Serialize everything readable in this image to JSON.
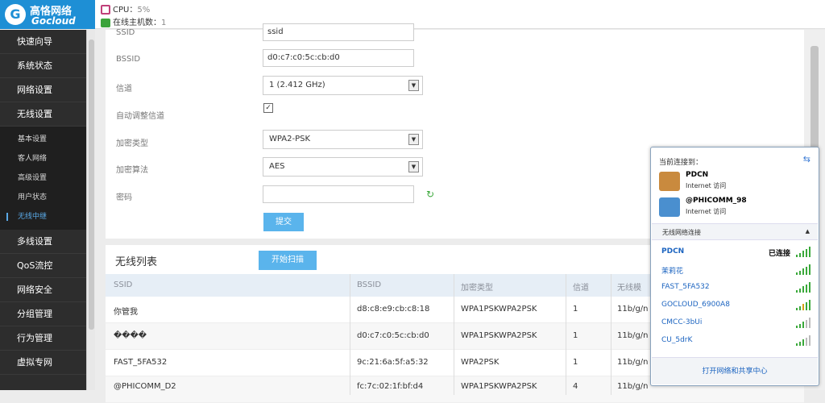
{
  "header": {
    "brand_cn": "高恪网络",
    "brand_en": "Gocloud",
    "cpu_label": "CPU：",
    "cpu_value": "5%",
    "hosts_label": "在线主机数：",
    "hosts_value": "1"
  },
  "sidebar": {
    "top_items": [
      {
        "label": "快速向导"
      },
      {
        "label": "系统状态"
      },
      {
        "label": "网络设置"
      },
      {
        "label": "无线设置"
      }
    ],
    "sub_items": [
      {
        "label": "基本设置"
      },
      {
        "label": "客人网络"
      },
      {
        "label": "高级设置"
      },
      {
        "label": "用户状态"
      },
      {
        "label": "无线中继"
      }
    ],
    "bottom_items": [
      {
        "label": "多线设置"
      },
      {
        "label": "QoS流控"
      },
      {
        "label": "网络安全"
      },
      {
        "label": "分组管理"
      },
      {
        "label": "行为管理"
      },
      {
        "label": "虚拟专网"
      }
    ]
  },
  "form": {
    "ssid_partial_label": "SSID",
    "ssid_value": "ssid",
    "bssid_label": "BSSID",
    "bssid_value": "d0:c7:c0:5c:cb:d0",
    "channel_label": "信道",
    "channel_value": "1 (2.412 GHz)",
    "auto_channel_label": "自动调整信道",
    "auto_channel_checked": true,
    "encryption_type_label": "加密类型",
    "encryption_type_value": "WPA2-PSK",
    "encryption_algo_label": "加密算法",
    "encryption_algo_value": "AES",
    "password_label": "密码",
    "password_value": "",
    "submit_label": "提交"
  },
  "wireless_list": {
    "title": "无线列表",
    "scan_label": "开始扫描",
    "columns": [
      "SSID",
      "BSSID",
      "加密类型",
      "信道",
      "无线模"
    ],
    "rows": [
      {
        "ssid": "你管我",
        "bssid": "d8:c8:e9:cb:c8:18",
        "enc": "WPA1PSKWPA2PSK",
        "channel": "1",
        "mode": "11b/g/n"
      },
      {
        "ssid": "����",
        "bssid": "d0:c7:c0:5c:cb:d0",
        "enc": "WPA1PSKWPA2PSK",
        "channel": "1",
        "mode": "11b/g/n"
      },
      {
        "ssid": "FAST_5FA532",
        "bssid": "9c:21:6a:5f:a5:32",
        "enc": "WPA2PSK",
        "channel": "1",
        "mode": "11b/g/n"
      },
      {
        "ssid": "@PHICOMM_D2",
        "bssid": "fc:7c:02:1f:bf:d4",
        "enc": "WPA1PSKWPA2PSK",
        "channel": "4",
        "mode": "11b/g/n"
      }
    ]
  },
  "network_popup": {
    "header": "当前连接到：",
    "connections": [
      {
        "name": "PDCN",
        "status": "Internet 访问"
      },
      {
        "name": "@PHICOMM_98",
        "status": "Internet 访问"
      }
    ],
    "section_title": "无线网络连接",
    "networks": [
      {
        "name": "PDCN",
        "status": "已连接",
        "signal": 5
      },
      {
        "name": "茉莉花",
        "status": "",
        "signal": 5
      },
      {
        "name": "FAST_5FA532",
        "status": "",
        "signal": 5
      },
      {
        "name": "GOCLOUD_6900A8",
        "status": "",
        "signal": 5
      },
      {
        "name": "CMCC-3bUi",
        "status": "",
        "signal": 3
      },
      {
        "name": "CU_5drK",
        "status": "",
        "signal": 3
      }
    ],
    "footer": "打开网络和共享中心"
  }
}
